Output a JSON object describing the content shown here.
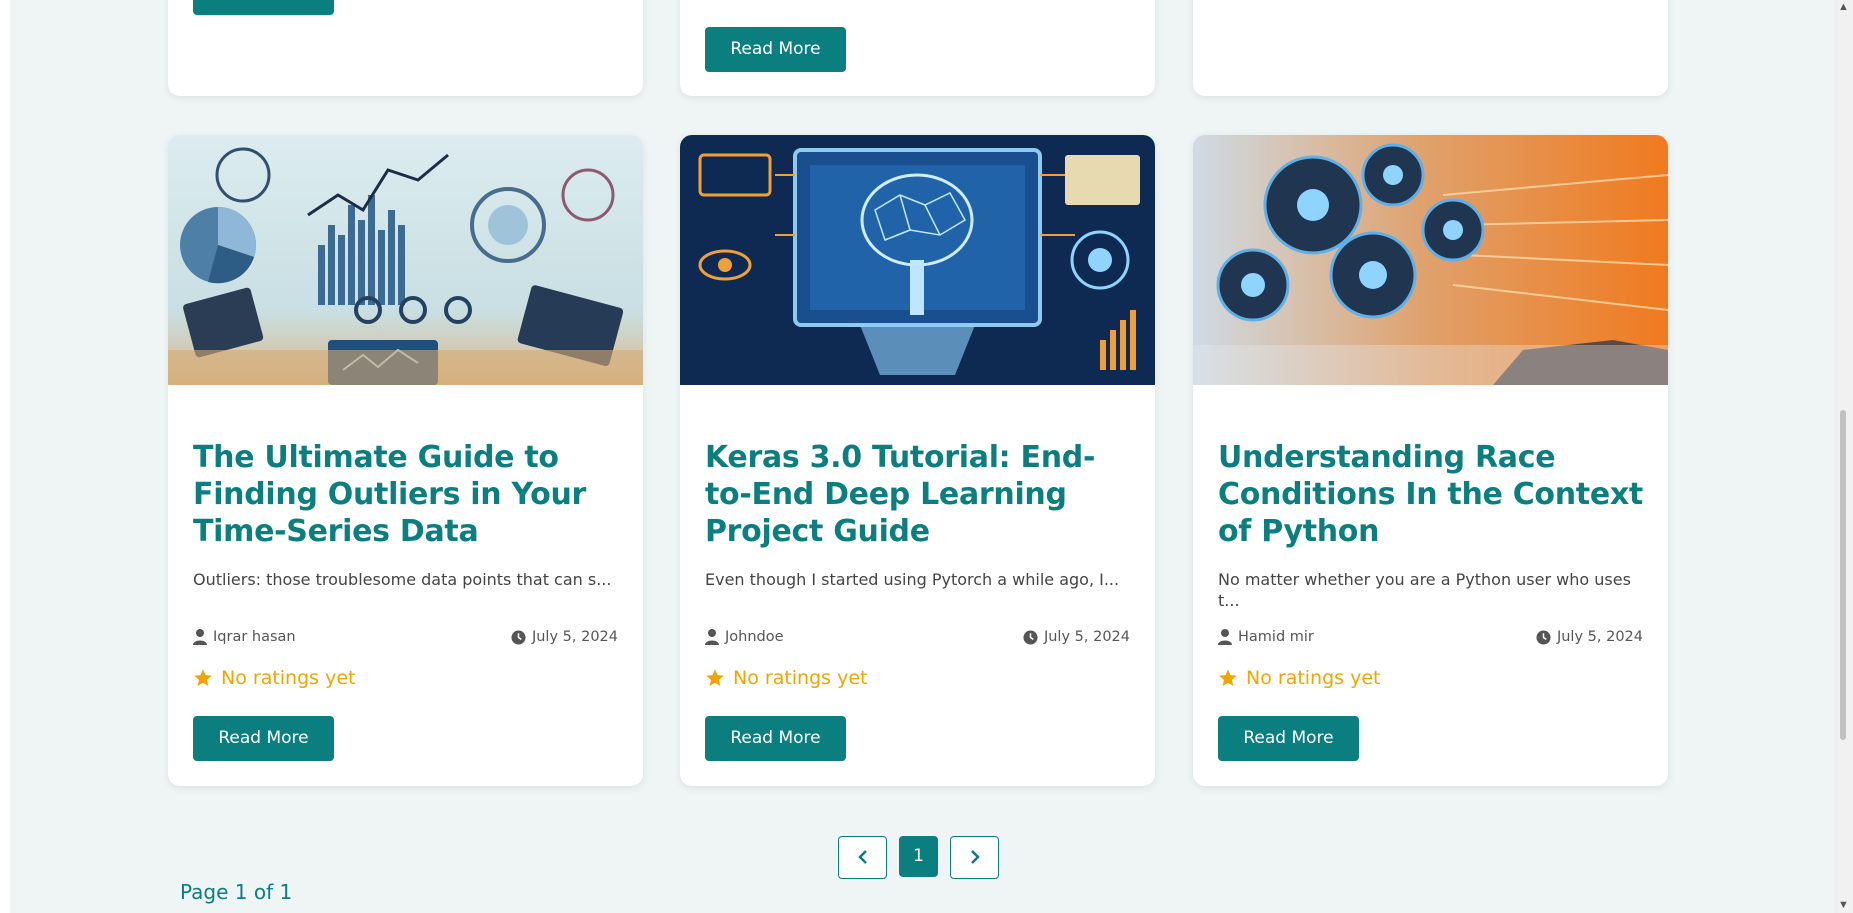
{
  "colors": {
    "accent": "#0b7f7f",
    "rating": "#f0a500",
    "background": "#eef5f4"
  },
  "top_row": {
    "read_more_1": "Read More",
    "read_more_2": "Read More"
  },
  "posts": [
    {
      "title": "The Ultimate Guide to Finding Outliers in Your Time-Series Data",
      "excerpt": "Outliers: those troublesome data points that can s...",
      "author": "Iqrar hasan",
      "date": "July 5, 2024",
      "rating": "No ratings yet",
      "button": "Read More"
    },
    {
      "title": "Keras 3.0 Tutorial: End-to-End Deep Learning Project Guide",
      "excerpt": "Even though I started using Pytorch a while ago, I...",
      "author": "Johndoe",
      "date": "July 5, 2024",
      "rating": "No ratings yet",
      "button": "Read More"
    },
    {
      "title": "Understanding Race Conditions In the Context of Python",
      "excerpt": "No matter whether you are a Python user who uses t...",
      "author": "Hamid mir",
      "date": "July 5, 2024",
      "rating": "No ratings yet",
      "button": "Read More"
    }
  ],
  "pagination": {
    "current": "1",
    "page_info": "Page 1 of 1",
    "prev_icon": "chevron-left-icon",
    "next_icon": "chevron-right-icon"
  }
}
